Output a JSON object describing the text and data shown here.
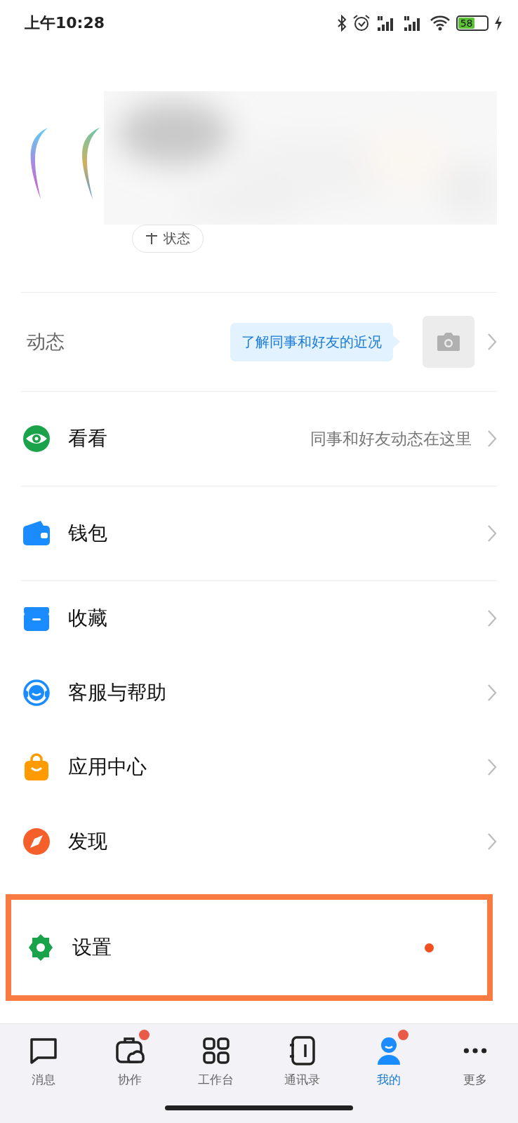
{
  "status_bar": {
    "time": "上午10:28",
    "battery": "58"
  },
  "profile": {
    "status_button": "状态"
  },
  "moments": {
    "label": "动态",
    "tip": "了解同事和好友的近况"
  },
  "menu": [
    {
      "label": "看看",
      "hint": "同事和好友动态在这里",
      "dot": false,
      "highlighted": false,
      "divider": true
    },
    {
      "label": "钱包",
      "dot": false,
      "highlighted": false,
      "divider": true
    },
    {
      "label": "收藏",
      "dot": false,
      "highlighted": false,
      "divider": false
    },
    {
      "label": "客服与帮助",
      "dot": false,
      "highlighted": false,
      "divider": false
    },
    {
      "label": "应用中心",
      "dot": false,
      "highlighted": false,
      "divider": false
    },
    {
      "label": "发现",
      "dot": false,
      "highlighted": false,
      "divider": false
    },
    {
      "label": "设置",
      "dot": true,
      "highlighted": true,
      "divider": false
    }
  ],
  "tab_bar": [
    {
      "label": "消息",
      "selected": false,
      "dot": false
    },
    {
      "label": "协作",
      "selected": false,
      "dot": true
    },
    {
      "label": "工作台",
      "selected": false,
      "dot": false
    },
    {
      "label": "通讯录",
      "selected": false,
      "dot": false
    },
    {
      "label": "我的",
      "selected": true,
      "dot": true
    },
    {
      "label": "更多",
      "selected": false,
      "dot": false
    }
  ]
}
